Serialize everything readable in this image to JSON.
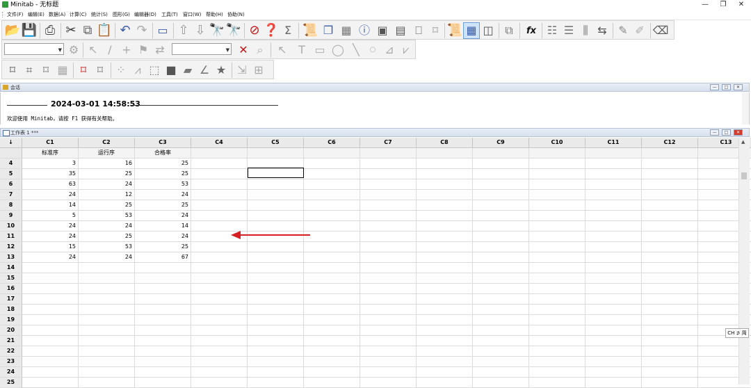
{
  "window": {
    "title": "Minitab - 无标题",
    "minimize": "—",
    "restore": "❐",
    "close": "✕"
  },
  "menu": [
    "文件(F)",
    "编辑(E)",
    "数据(A)",
    "计算(C)",
    "统计(S)",
    "图形(G)",
    "编辑器(D)",
    "工具(T)",
    "窗口(W)",
    "帮助(H)",
    "协助(N)"
  ],
  "session": {
    "title": "会话",
    "timestamp": "2024-03-01 14:58:53",
    "welcome": "欢迎使用 Minitab，请按 F1 获得有关帮助。"
  },
  "worksheet": {
    "title": "工作表 1 ***",
    "corner": "↓",
    "columns": [
      "C1",
      "C2",
      "C3",
      "C4",
      "C5",
      "C6",
      "C7",
      "C8",
      "C9",
      "C10",
      "C11",
      "C12",
      "C13"
    ],
    "names": [
      "标准序",
      "运行序",
      "合格率",
      "",
      "",
      "",
      "",
      "",
      "",
      "",
      "",
      "",
      ""
    ],
    "rows": [
      {
        "n": "4",
        "v": [
          "3",
          "16",
          "25"
        ]
      },
      {
        "n": "5",
        "v": [
          "35",
          "25",
          "25"
        ]
      },
      {
        "n": "6",
        "v": [
          "63",
          "24",
          "53"
        ]
      },
      {
        "n": "7",
        "v": [
          "24",
          "12",
          "24"
        ]
      },
      {
        "n": "8",
        "v": [
          "14",
          "25",
          "25"
        ]
      },
      {
        "n": "9",
        "v": [
          "5",
          "53",
          "24"
        ]
      },
      {
        "n": "10",
        "v": [
          "24",
          "24",
          "14"
        ]
      },
      {
        "n": "11",
        "v": [
          "24",
          "25",
          "24"
        ]
      },
      {
        "n": "12",
        "v": [
          "15",
          "53",
          "25"
        ]
      },
      {
        "n": "13",
        "v": [
          "24",
          "24",
          "67"
        ]
      },
      {
        "n": "14",
        "v": [
          "",
          "",
          ""
        ]
      },
      {
        "n": "15",
        "v": [
          "",
          "",
          ""
        ]
      },
      {
        "n": "16",
        "v": [
          "",
          "",
          ""
        ]
      },
      {
        "n": "17",
        "v": [
          "",
          "",
          ""
        ]
      },
      {
        "n": "18",
        "v": [
          "",
          "",
          ""
        ]
      },
      {
        "n": "19",
        "v": [
          "",
          "",
          ""
        ]
      },
      {
        "n": "20",
        "v": [
          "",
          "",
          ""
        ]
      },
      {
        "n": "21",
        "v": [
          "",
          "",
          ""
        ]
      },
      {
        "n": "22",
        "v": [
          "",
          "",
          ""
        ]
      },
      {
        "n": "23",
        "v": [
          "",
          "",
          ""
        ]
      },
      {
        "n": "24",
        "v": [
          "",
          "",
          ""
        ]
      },
      {
        "n": "25",
        "v": [
          "",
          "",
          ""
        ]
      }
    ]
  },
  "ime": "CH ⊅ 简",
  "colors": {
    "accent": "#3a5da8",
    "annotation": "#d42020"
  },
  "icons": {
    "toolbar1": [
      "open-icon",
      "save-icon",
      "print-icon",
      "cut-icon",
      "copy-icon",
      "paste-icon",
      "undo-icon",
      "redo-icon",
      "session-window-icon",
      "previous-icon",
      "next-icon",
      "find-icon",
      "find-next-icon",
      "cancel-icon",
      "help-icon",
      "stat-guide-icon",
      "report-pad-icon",
      "tile-icon",
      "worksheet-icon",
      "info-icon",
      "project-manager-icon",
      "history-icon",
      "new-graph-icon",
      "graph-folder-icon",
      "show-worksheet-icon",
      "show-graph-icon",
      "close-all-icon",
      "formula-icon",
      "insert-cells-icon",
      "insert-rows-icon",
      "insert-columns-icon",
      "move-columns-icon",
      "brush-icon",
      "set-id-icon",
      "eraser-icon"
    ]
  }
}
